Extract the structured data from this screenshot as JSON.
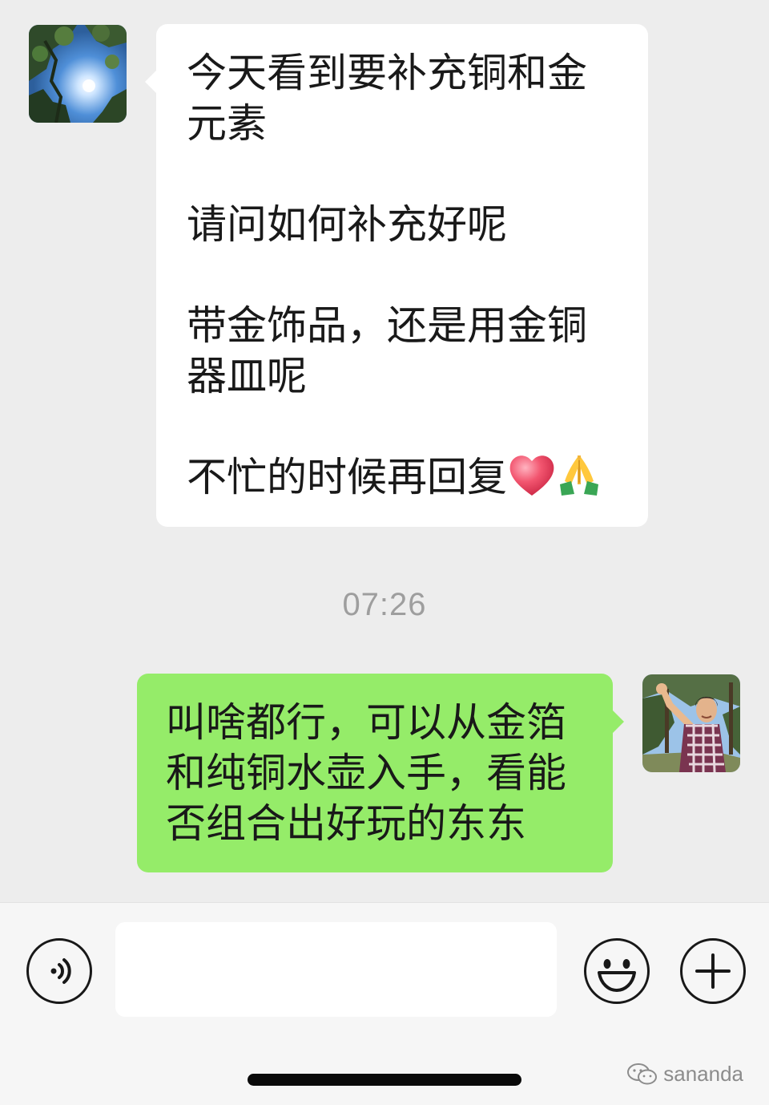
{
  "chat": {
    "incoming": {
      "avatar_icon": "forest-sunlight-avatar",
      "paragraphs": [
        "今天看到要补充铜和金元素",
        "请问如何补充好呢",
        "带金饰品，还是用金铜器皿呢",
        "不忙的时候再回复"
      ],
      "trailing_emojis": [
        "heart-icon",
        "folded-hands-icon"
      ]
    },
    "timestamp": "07:26",
    "outgoing": {
      "avatar_icon": "person-waving-avatar",
      "text": "叫啥都行，可以从金箔和纯铜水壶入手，看能否组合出好玩的东东",
      "bubble_color": "#95ec69"
    }
  },
  "input_bar": {
    "voice_icon": "voice-icon",
    "message_value": "",
    "emoji_icon": "smiley-icon",
    "more_icon": "plus-icon"
  },
  "watermark": {
    "text": "sananda",
    "icon": "wechat-icon"
  }
}
